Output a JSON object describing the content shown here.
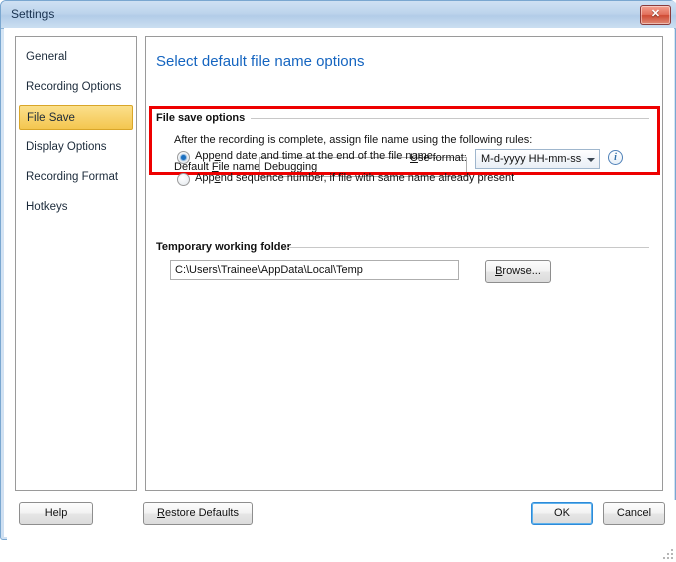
{
  "window": {
    "title": "Settings",
    "close_label": "✕",
    "close_icon": "close-icon"
  },
  "sidebar": {
    "items": [
      {
        "label": "General",
        "selected": false
      },
      {
        "label": "Recording Options",
        "selected": false
      },
      {
        "label": "File Save",
        "selected": true
      },
      {
        "label": "Display Options",
        "selected": false
      },
      {
        "label": "Recording Format",
        "selected": false
      },
      {
        "label": "Hotkeys",
        "selected": false
      }
    ]
  },
  "panel": {
    "title": "Select default file name options",
    "file_save_group": {
      "legend": "File save options",
      "description": "After the recording is complete, assign file name using the following rules:",
      "default_file_name_label_pre": "Default ",
      "default_file_name_label_acc": "F",
      "default_file_name_label_post": "ile name:",
      "default_file_name_value": "Debugging",
      "highlighted": true,
      "highlight_color": "#ee0000"
    },
    "radios": [
      {
        "id": "append-date-time",
        "label_pre": "App",
        "label_acc": "e",
        "label_post": "nd date and time at the end of the file name.",
        "checked": true
      },
      {
        "id": "append-sequence-number",
        "label_pre": "App",
        "label_acc": "e",
        "label_post": "nd sequence number, if file with same name already present",
        "checked": false
      }
    ],
    "use_format": {
      "label_pre": "",
      "label_acc": "U",
      "label_post": "se format:",
      "selected_value": "M-d-yyyy HH-mm-ss",
      "options": [
        "M-d-yyyy HH-mm-ss"
      ]
    },
    "info_icon": {
      "glyph": "i",
      "name": "info-icon"
    },
    "temp_folder_group": {
      "legend": "Temporary working folder",
      "path_value": "C:\\Users\\Trainee\\AppData\\Local\\Temp",
      "browse_pre": "",
      "browse_acc": "B",
      "browse_post": "rowse..."
    }
  },
  "footer": {
    "help": "Help",
    "restore_defaults_pre": "",
    "restore_defaults_acc": "R",
    "restore_defaults_post": "estore Defaults",
    "ok": "OK",
    "cancel": "Cancel"
  },
  "colors": {
    "accent_blue": "#1565c0",
    "selected_item": "#f7d16a",
    "highlight_red": "#ee0000",
    "titlebar": "#bdd4ec"
  }
}
